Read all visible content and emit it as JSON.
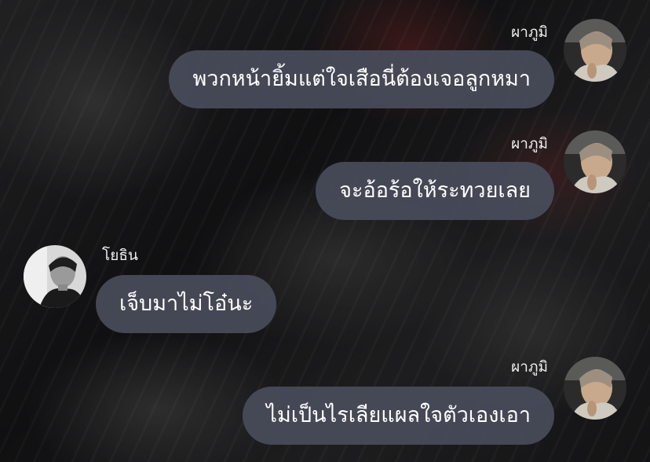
{
  "chat": {
    "messages": [
      {
        "sender": "ผาภูมิ",
        "text": "พวกหน้ายิ้มแต่ใจเสือนี่ต้องเจอลูกหมา",
        "side": "right"
      },
      {
        "sender": "ผาภูมิ",
        "text": "จะอ้อร้อให้ระทวยเลย",
        "side": "right"
      },
      {
        "sender": "โยธิน",
        "text": "เจ็บมาไม่โอ๋นะ",
        "side": "left"
      },
      {
        "sender": "ผาภูมิ",
        "text": "ไม่เป็นไรเลียแผลใจตัวเองเอา",
        "side": "right"
      }
    ]
  },
  "colors": {
    "bubble": "#484c5a",
    "text": "#ffffff",
    "sender": "#eeeeee"
  },
  "avatars": {
    "right_user": "avatar-photo-paphum",
    "left_user": "avatar-photo-yothin"
  }
}
